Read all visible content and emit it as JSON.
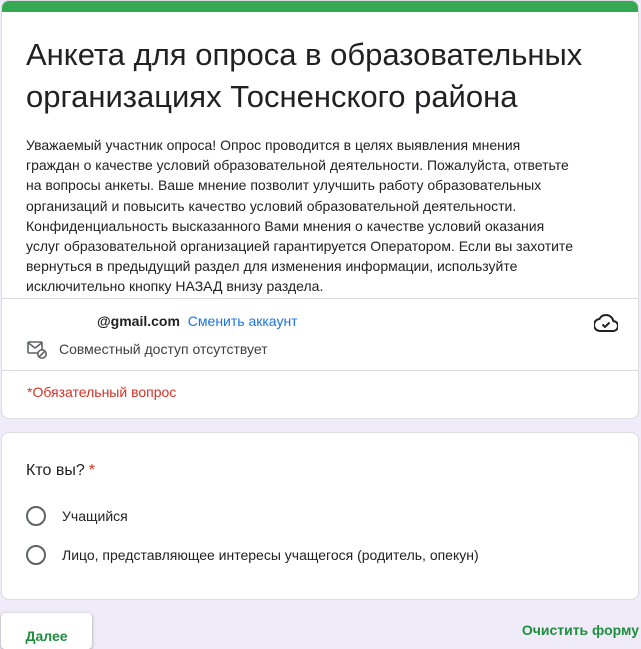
{
  "header": {
    "title": "Анкета для опроса в образовательных организациях Тосненского района",
    "description": "Уважаемый участник опроса! Опрос проводится в целях выявления мнения\nграждан о качестве условий образовательной деятельности. Пожалуйста, ответьте\nна вопросы анкеты. Ваше мнение позволит улучшить работу образовательных\nорганизаций и повысить качество условий образовательной деятельности.\nКонфиденциальность высказанного Вами мнения о качестве условий оказания\nуслуг образовательной организацией гарантируется Оператором. Если вы захотите\nвернуться в предыдущий раздел для изменения информации, используйте\nисключительно кнопку НАЗАД внизу раздела.",
    "accent_color": "#34a853"
  },
  "account": {
    "email": "@gmail.com",
    "switch_label": "Сменить аккаунт",
    "cloud_icon": "cloud-saved-icon"
  },
  "sharing": {
    "icon": "no-share-email-icon",
    "label": "Совместный доступ отсутствует"
  },
  "required_note": "*Обязательный вопрос",
  "question": {
    "title": "Кто вы?",
    "required_mark": "*",
    "options": [
      {
        "label": "Учащийся"
      },
      {
        "label": "Лицо, представляющее интересы учащегося (родитель, опекун)"
      }
    ]
  },
  "footer": {
    "next_label": "Далее",
    "clear_label": "Очистить форму"
  },
  "colors": {
    "background": "#f0ebf8",
    "link": "#1a73e8",
    "required": "#d93025",
    "action": "#1e8e3e"
  }
}
